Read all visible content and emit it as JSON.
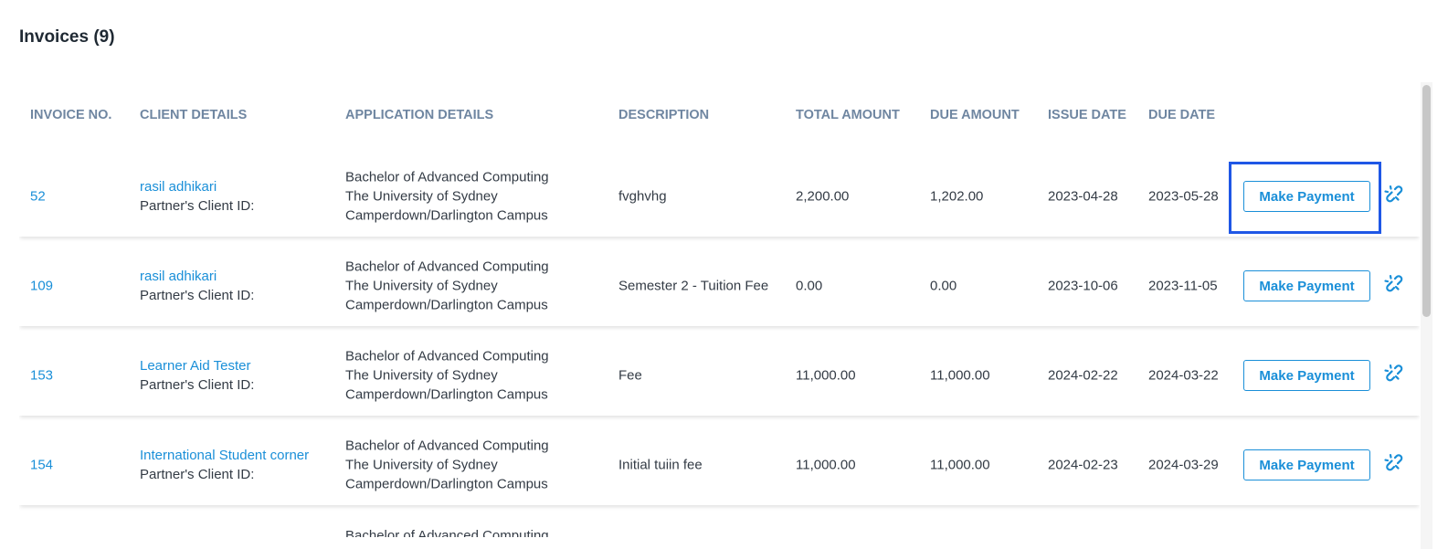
{
  "title": "Invoices (9)",
  "columns": {
    "invoice_no": "INVOICE NO.",
    "client_details": "CLIENT DETAILS",
    "application_details": "APPLICATION DETAILS",
    "description": "DESCRIPTION",
    "total_amount": "TOTAL AMOUNT",
    "due_amount": "DUE AMOUNT",
    "issue_date": "ISSUE DATE",
    "due_date": "DUE DATE"
  },
  "rows": [
    {
      "invoice_no": "52",
      "client_name": "rasil adhikari",
      "client_id_label": "Partner's Client ID:",
      "course": "Bachelor of Advanced Computing",
      "university": "The University of Sydney",
      "campus": "Camperdown/Darlington Campus",
      "description": "fvghvhg",
      "total_amount": "2,200.00",
      "due_amount": "1,202.00",
      "issue_date": "2023-04-28",
      "due_date": "2023-05-28",
      "action_label": "Make Payment"
    },
    {
      "invoice_no": "109",
      "client_name": "rasil adhikari",
      "client_id_label": "Partner's Client ID:",
      "course": "Bachelor of Advanced Computing",
      "university": "The University of Sydney",
      "campus": "Camperdown/Darlington Campus",
      "description": "Semester 2 - Tuition Fee",
      "total_amount": "0.00",
      "due_amount": "0.00",
      "issue_date": "2023-10-06",
      "due_date": "2023-11-05",
      "action_label": "Make Payment"
    },
    {
      "invoice_no": "153",
      "client_name": "Learner Aid Tester",
      "client_id_label": "Partner's Client ID:",
      "course": "Bachelor of Advanced Computing",
      "university": "The University of Sydney",
      "campus": "Camperdown/Darlington Campus",
      "description": "Fee",
      "total_amount": "11,000.00",
      "due_amount": "11,000.00",
      "issue_date": "2024-02-22",
      "due_date": "2024-03-22",
      "action_label": "Make Payment"
    },
    {
      "invoice_no": "154",
      "client_name": "International Student corner",
      "client_id_label": "Partner's Client ID:",
      "course": "Bachelor of Advanced Computing",
      "university": "The University of Sydney",
      "campus": "Camperdown/Darlington Campus",
      "description": "Initial tuiin fee",
      "total_amount": "11,000.00",
      "due_amount": "11,000.00",
      "issue_date": "2024-02-23",
      "due_date": "2024-03-29",
      "action_label": "Make Payment"
    }
  ],
  "partial_row": {
    "course": "Bachelor of Advanced Computing"
  },
  "icons": {
    "row_action": "broken-link-icon"
  },
  "colors": {
    "link": "#1a8fd8",
    "header": "#6f86a1",
    "highlight": "#1f57e6"
  }
}
